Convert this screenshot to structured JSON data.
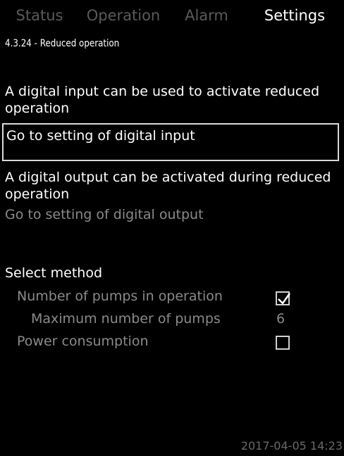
{
  "tabs": [
    {
      "label": "Status",
      "active": false
    },
    {
      "label": "Operation",
      "active": false
    },
    {
      "label": "Alarm",
      "active": false
    },
    {
      "label": "Settings",
      "active": true
    }
  ],
  "breadcrumb": "4.3.24 - Reduced operation",
  "digital_input": {
    "description": "A digital input can be used to activate reduced operation",
    "link_label": "Go to setting of digital input"
  },
  "digital_output": {
    "description": "A digital output can be activated during reduced operation",
    "link_label": "Go to setting of digital output"
  },
  "select_method": {
    "heading": "Select method",
    "options": [
      {
        "label": "Number of pumps in operation",
        "checked": true
      },
      {
        "label": "Maximum number of pumps",
        "value": "6"
      },
      {
        "label": "Power consumption",
        "checked": false
      }
    ]
  },
  "footer": {
    "datetime": "2017-04-05 14:23"
  },
  "colors": {
    "background": "#000000",
    "text": "#ffffff",
    "dim_text": "#8a8a8a",
    "inactive_tab": "#5a5a5a"
  }
}
